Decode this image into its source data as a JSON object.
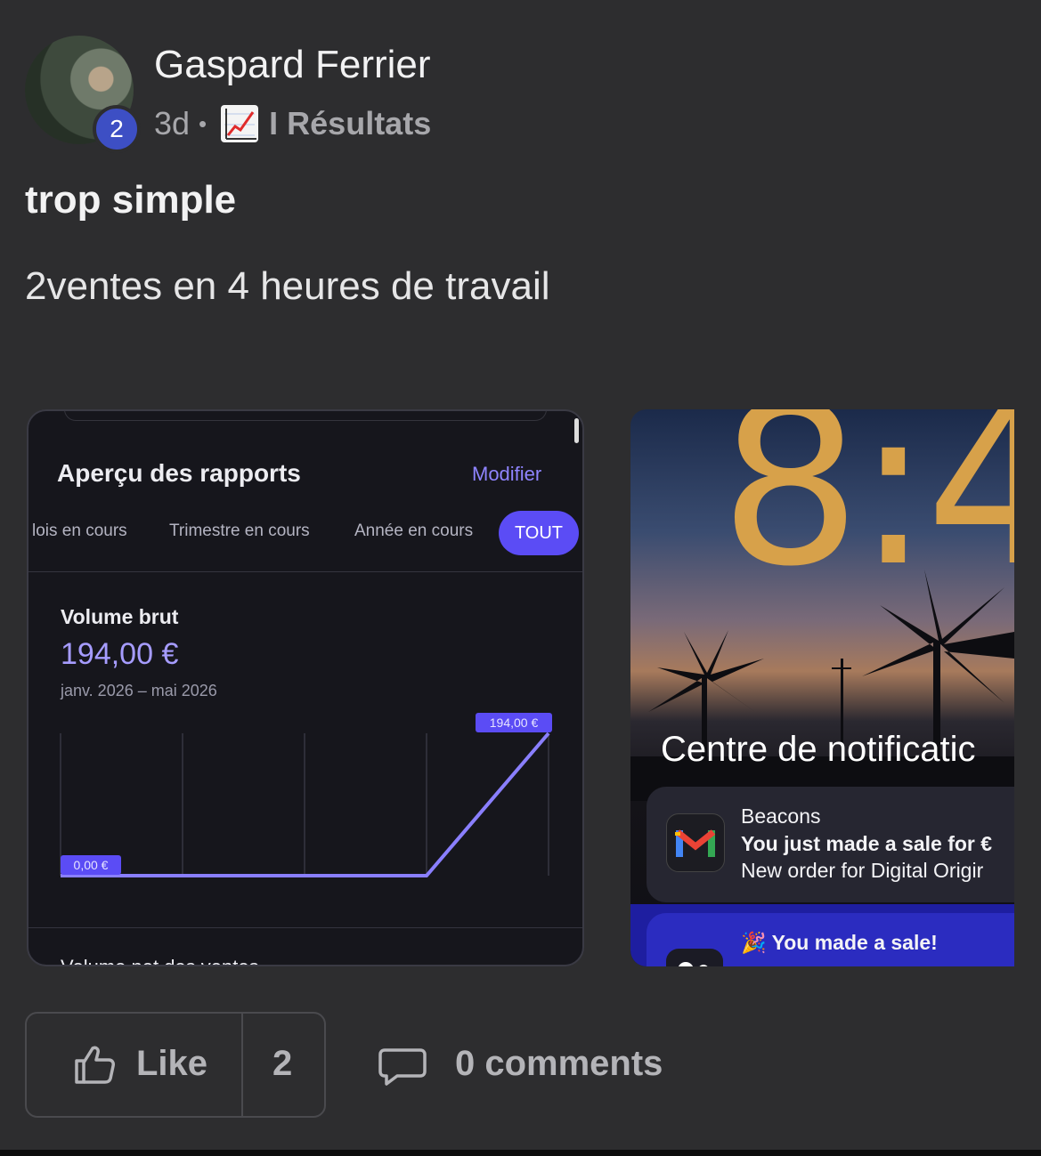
{
  "post": {
    "author": "Gaspard Ferrier",
    "level_badge": "2",
    "time": "3d",
    "separator": "•",
    "category_icon": "chart-increasing-emoji",
    "category": "I Résultats",
    "title": "trop simple",
    "body": "2ventes en 4 heures de travail"
  },
  "image1": {
    "heading": "Aperçu des rapports",
    "modify": "Modifier",
    "tabs": [
      "lois en cours",
      "Trimestre en cours",
      "Année en cours",
      "TOUT"
    ],
    "volume_label": "Volume brut",
    "volume_value": "194,00 €",
    "date_range": "janv. 2026 – mai 2026",
    "cut_text": "Volume net des ventes",
    "accent": "#5b4cf5",
    "chart_data": {
      "type": "line",
      "x": [
        "janv. 2026",
        "",
        "",
        "",
        "mai 2026"
      ],
      "values": [
        0,
        0,
        0,
        0,
        194
      ],
      "start_label": "0,00 €",
      "end_label": "194,00 €"
    }
  },
  "image2": {
    "clock": "8:4",
    "notification_center": "Centre de notificatic",
    "notif1": {
      "app": "Beacons",
      "line1": "You just made a sale for €",
      "line2": "New order for Digital Origir",
      "icon": "gmail-icon"
    },
    "notif2": {
      "line1": "🎉 You made a sale!",
      "icon": "app-icon"
    }
  },
  "actions": {
    "like_label": "Like",
    "like_count": "2",
    "comments_label": "0 comments"
  }
}
